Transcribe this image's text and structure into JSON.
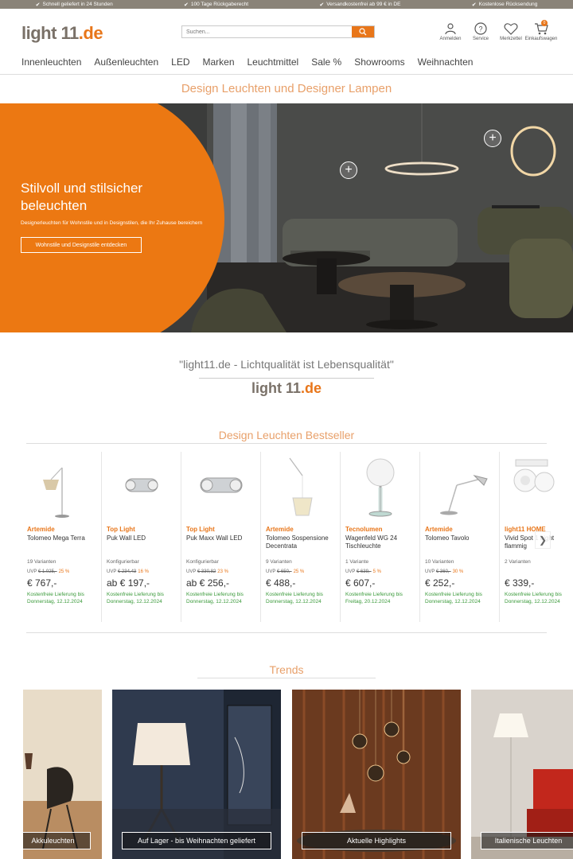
{
  "usp": [
    "Schnell geliefert in 24 Stunden",
    "100 Tage Rückgaberecht",
    "Versandkostenfrei ab 99 € in DE",
    "Kostenlose Rücksendung"
  ],
  "header": {
    "logo_main": "light 11",
    "logo_accent": ".de",
    "search_placeholder": "Suchen...",
    "icons": [
      {
        "label": "Anmelden",
        "icon": "user-icon"
      },
      {
        "label": "Service",
        "icon": "help-icon"
      },
      {
        "label": "Merkzettel",
        "icon": "heart-icon"
      },
      {
        "label": "Einkaufswagen",
        "icon": "cart-icon",
        "badge": "0"
      }
    ]
  },
  "nav": [
    "Innenleuchten",
    "Außenleuchten",
    "LED",
    "Marken",
    "Leuchtmittel",
    "Sale %",
    "Showrooms",
    "Weihnachten"
  ],
  "page_headline": "Design Leuchten und Designer Lampen",
  "hero": {
    "title": "Stilvoll und stilsicher beleuchten",
    "subtitle": "Designerleuchten für Wohnstile und in Designstilen, die Ihr Zuhause bereichern",
    "cta": "Wohnstile und Designstile entdecken"
  },
  "quote": {
    "text": "\"light11.de - Lichtqualität ist Lebensqualität\"",
    "logo_main": "light 11",
    "logo_accent": ".de"
  },
  "bestseller": {
    "heading": "Design Leuchten Bestseller",
    "products": [
      {
        "brand": "Artemide",
        "name": "Tolomeo Mega Terra",
        "variants": "19 Varianten",
        "uvp_prefix": "UVP",
        "uvp": "€ 1.025,-",
        "discount": "25 %",
        "price": "€ 767,-",
        "delivery": "Kostenfreie Lieferung bis Donnerstag, 12.12.2024",
        "icon": "floor-lamp-icon"
      },
      {
        "brand": "Top Light",
        "name": "Puk Wall LED",
        "variants": "Konfigurierbar",
        "uvp_prefix": "UVP",
        "uvp": "€ 234,43",
        "discount": "16 %",
        "price": "ab € 197,-",
        "delivery": "Kostenfreie Lieferung bis Donnerstag, 12.12.2024",
        "icon": "wall-lamp-icon"
      },
      {
        "brand": "Top Light",
        "name": "Puk Maxx Wall LED",
        "variants": "Konfigurierbar",
        "uvp_prefix": "UVP",
        "uvp": "€ 330,82",
        "discount": "23 %",
        "price": "ab € 256,-",
        "delivery": "Kostenfreie Lieferung bis Donnerstag, 12.12.2024",
        "icon": "wall-lamp-icon"
      },
      {
        "brand": "Artemide",
        "name": "Tolomeo Sospensione Decentrata",
        "variants": "9 Varianten",
        "uvp_prefix": "UVP",
        "uvp": "€ 650,-",
        "discount": "25 %",
        "price": "€ 488,-",
        "delivery": "Kostenfreie Lieferung bis Donnerstag, 12.12.2024",
        "icon": "pendant-lamp-icon"
      },
      {
        "brand": "Tecnolumen",
        "name": "Wagenfeld WG 24 Tischleuchte",
        "variants": "1 Variante",
        "uvp_prefix": "UVP",
        "uvp": "€ 639,-",
        "discount": "5 %",
        "price": "€ 607,-",
        "delivery": "Kostenfreie Lieferung bis Freitag, 20.12.2024",
        "icon": "table-lamp-icon"
      },
      {
        "brand": "Artemide",
        "name": "Tolomeo Tavolo",
        "variants": "10 Varianten",
        "uvp_prefix": "UVP",
        "uvp": "€ 360,-",
        "discount": "30 %",
        "price": "€ 252,-",
        "delivery": "Kostenfreie Lieferung bis Donnerstag, 12.12.2024",
        "icon": "desk-lamp-icon"
      },
      {
        "brand": "light11 HOME",
        "name": "Vivid Spot 1 Light flammig",
        "variants": "2 Varianten",
        "uvp_prefix": "",
        "uvp": "",
        "discount": "",
        "price": "€ 339,-",
        "delivery": "Kostenfreie Lieferung bis Donnerstag, 12.12.2024",
        "icon": "spot-lamp-icon"
      }
    ]
  },
  "trends": {
    "heading": "Trends",
    "tiles": [
      {
        "label": "Akkuleuchten"
      },
      {
        "label": "Auf Lager - bis Weihnachten geliefert"
      },
      {
        "label": "Aktuelle Highlights"
      },
      {
        "label": "Italienische Leuchten"
      }
    ]
  }
}
